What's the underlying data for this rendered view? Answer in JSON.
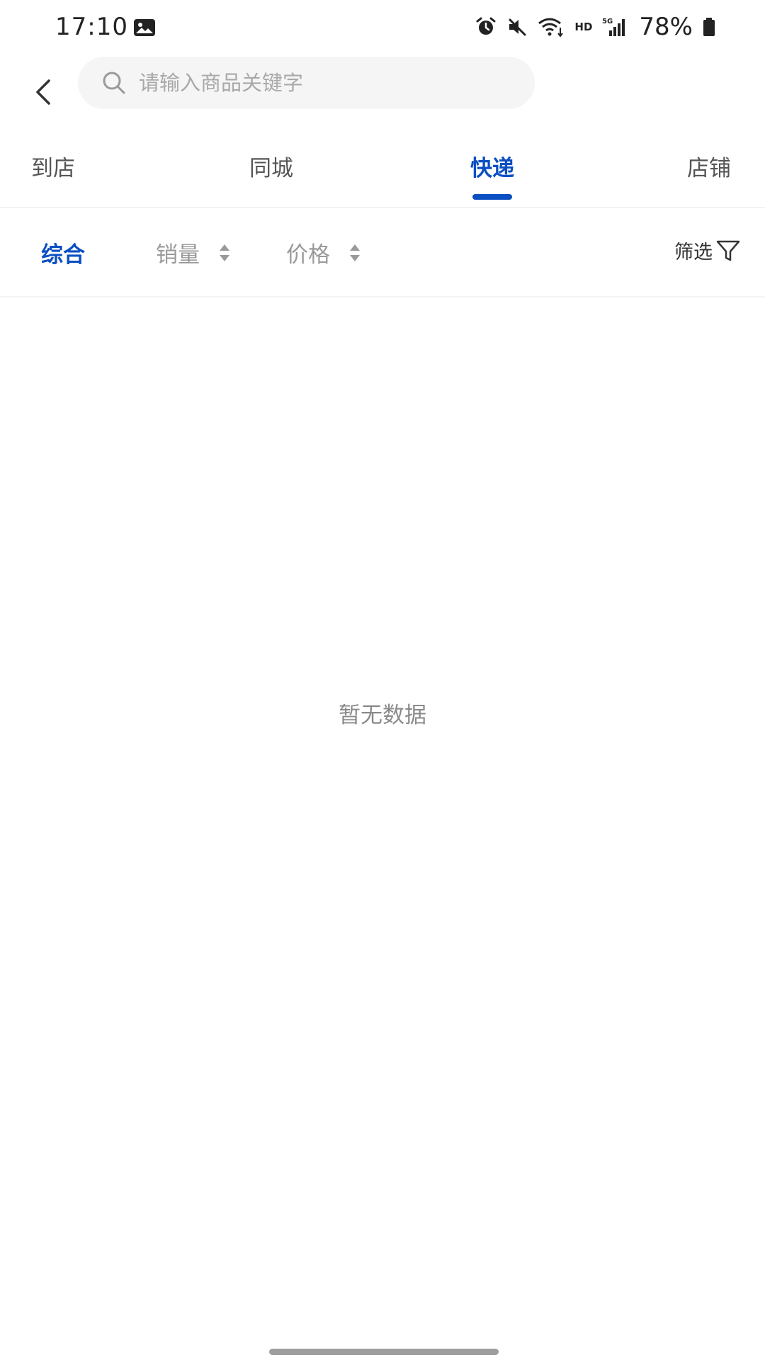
{
  "status_bar": {
    "time": "17:10",
    "network_hd": "HD",
    "network_type": "5G",
    "battery": "78%",
    "icons": [
      "gallery-icon",
      "alarm-icon",
      "mute-icon",
      "wifi-icon",
      "signal-icon",
      "battery-icon"
    ]
  },
  "header": {
    "back_icon": "chevron-left-icon",
    "search": {
      "placeholder": "请输入商品关键字",
      "value": "",
      "icon": "search-icon"
    }
  },
  "tabs": [
    {
      "label": "到店",
      "active": false
    },
    {
      "label": "同城",
      "active": false
    },
    {
      "label": "快递",
      "active": true
    },
    {
      "label": "店铺",
      "active": false
    }
  ],
  "sort_bar": {
    "items": [
      {
        "label": "综合",
        "active": true
      },
      {
        "label": "销量",
        "active": false
      },
      {
        "label": "价格",
        "active": false
      }
    ],
    "filter_label": "筛选",
    "filter_icon": "funnel-icon"
  },
  "empty_state": {
    "text": "暂无数据"
  },
  "colors": {
    "accent": "#0b4fc2",
    "muted_text": "#9a9a9a",
    "search_bg": "#f5f5f5"
  }
}
